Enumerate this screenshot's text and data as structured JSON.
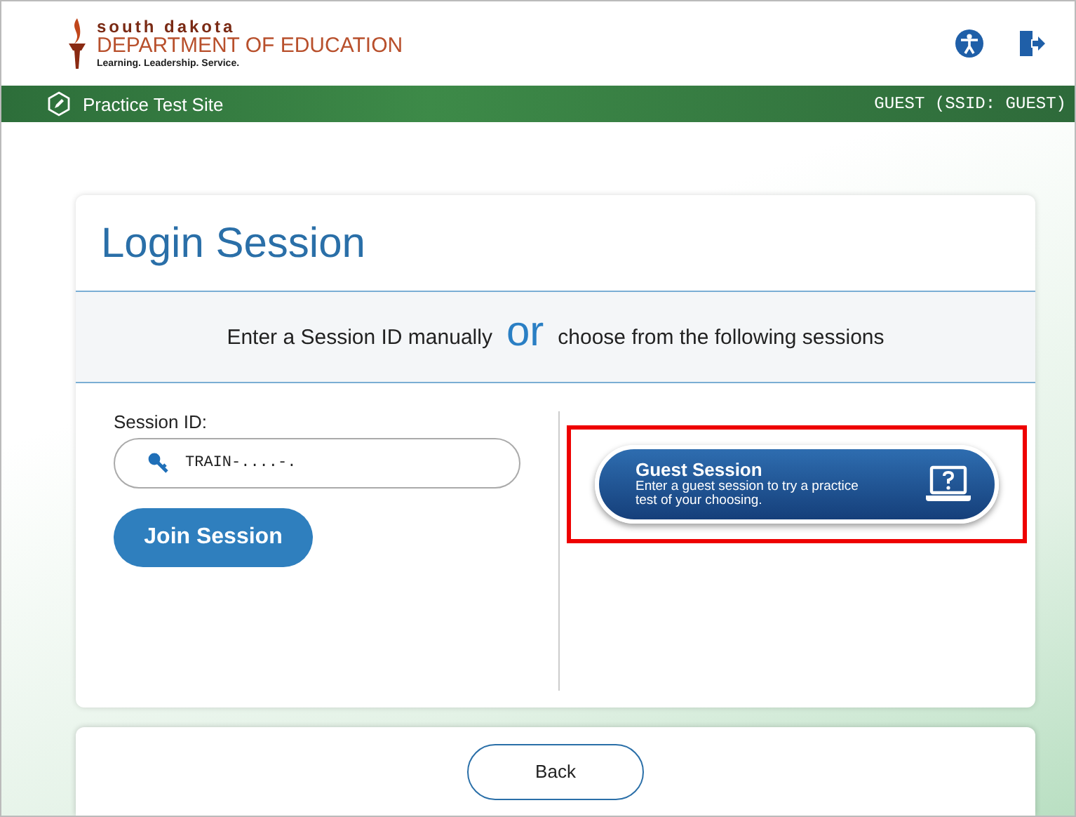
{
  "header": {
    "logo": {
      "line_1": "south dakota",
      "line_2": "DEPARTMENT OF EDUCATION",
      "tagline": "Learning. Leadership. Service."
    }
  },
  "site_bar": {
    "title": "Practice Test Site",
    "user": "GUEST (SSID: GUEST)"
  },
  "login": {
    "title": "Login Session",
    "instruction_before": "Enter a Session ID manually",
    "or": "or",
    "instruction_after": "choose from the following sessions",
    "field_label": "Session ID:",
    "field_value": "TRAIN-....-.",
    "join_button": "Join Session",
    "guest_session": {
      "title": "Guest Session",
      "description": "Enter a guest session to try a practice test of your choosing.",
      "highlighted": true
    }
  },
  "footer": {
    "back_button": "Back"
  }
}
